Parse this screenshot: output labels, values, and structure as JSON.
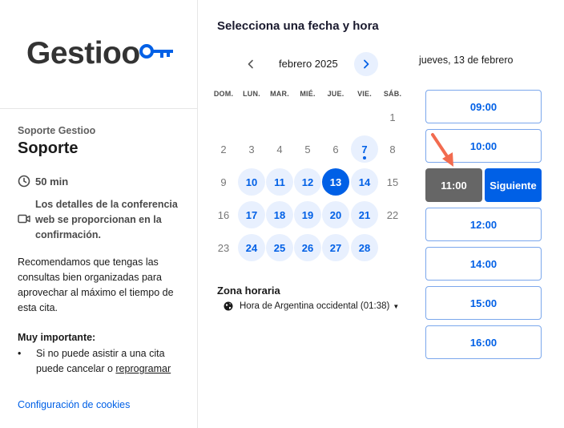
{
  "brand": {
    "logo_text": "Gestioo",
    "accent": "#0060e6"
  },
  "event": {
    "subtitle": "Soporte Gestioo",
    "title": "Soporte",
    "duration": "50 min",
    "conference": "Los detalles de la conferencia web se proporcionan en la confirmación.",
    "recommendation": "Recomendamos que tengas las consultas bien organizadas para aprovechar al máximo el tiempo de esta cita.",
    "important_title": "Muy importante:",
    "important_text": "Si no puede asistir a una cita puede cancelar o ",
    "important_link": "reprogramar",
    "cookies": "Configuración de cookies"
  },
  "calendar": {
    "heading": "Selecciona una fecha y hora",
    "month": "febrero 2025",
    "weekdays": [
      "DOM.",
      "LUN.",
      "MAR.",
      "MIÉ.",
      "JUE.",
      "VIE.",
      "SÁB."
    ],
    "weeks": [
      [
        "",
        "",
        "",
        "",
        "",
        "",
        "1"
      ],
      [
        "2",
        "3",
        "4",
        "5",
        "6",
        "7",
        "8"
      ],
      [
        "9",
        "10",
        "11",
        "12",
        "13",
        "14",
        "15"
      ],
      [
        "16",
        "17",
        "18",
        "19",
        "20",
        "21",
        "22"
      ],
      [
        "23",
        "24",
        "25",
        "26",
        "27",
        "28",
        ""
      ]
    ],
    "available": [
      "10",
      "11",
      "12",
      "14",
      "17",
      "18",
      "19",
      "20",
      "21",
      "24",
      "25",
      "26",
      "27",
      "28"
    ],
    "selected": "13",
    "today": "7"
  },
  "timezone": {
    "title": "Zona horaria",
    "value": "Hora de Argentina occidental (01:38)"
  },
  "slots": {
    "date_label": "jueves, 13 de febrero",
    "before": [
      "09:00",
      "10:00"
    ],
    "selected": "11:00",
    "next_label": "Siguiente",
    "after": [
      "12:00",
      "14:00",
      "15:00",
      "16:00"
    ]
  }
}
